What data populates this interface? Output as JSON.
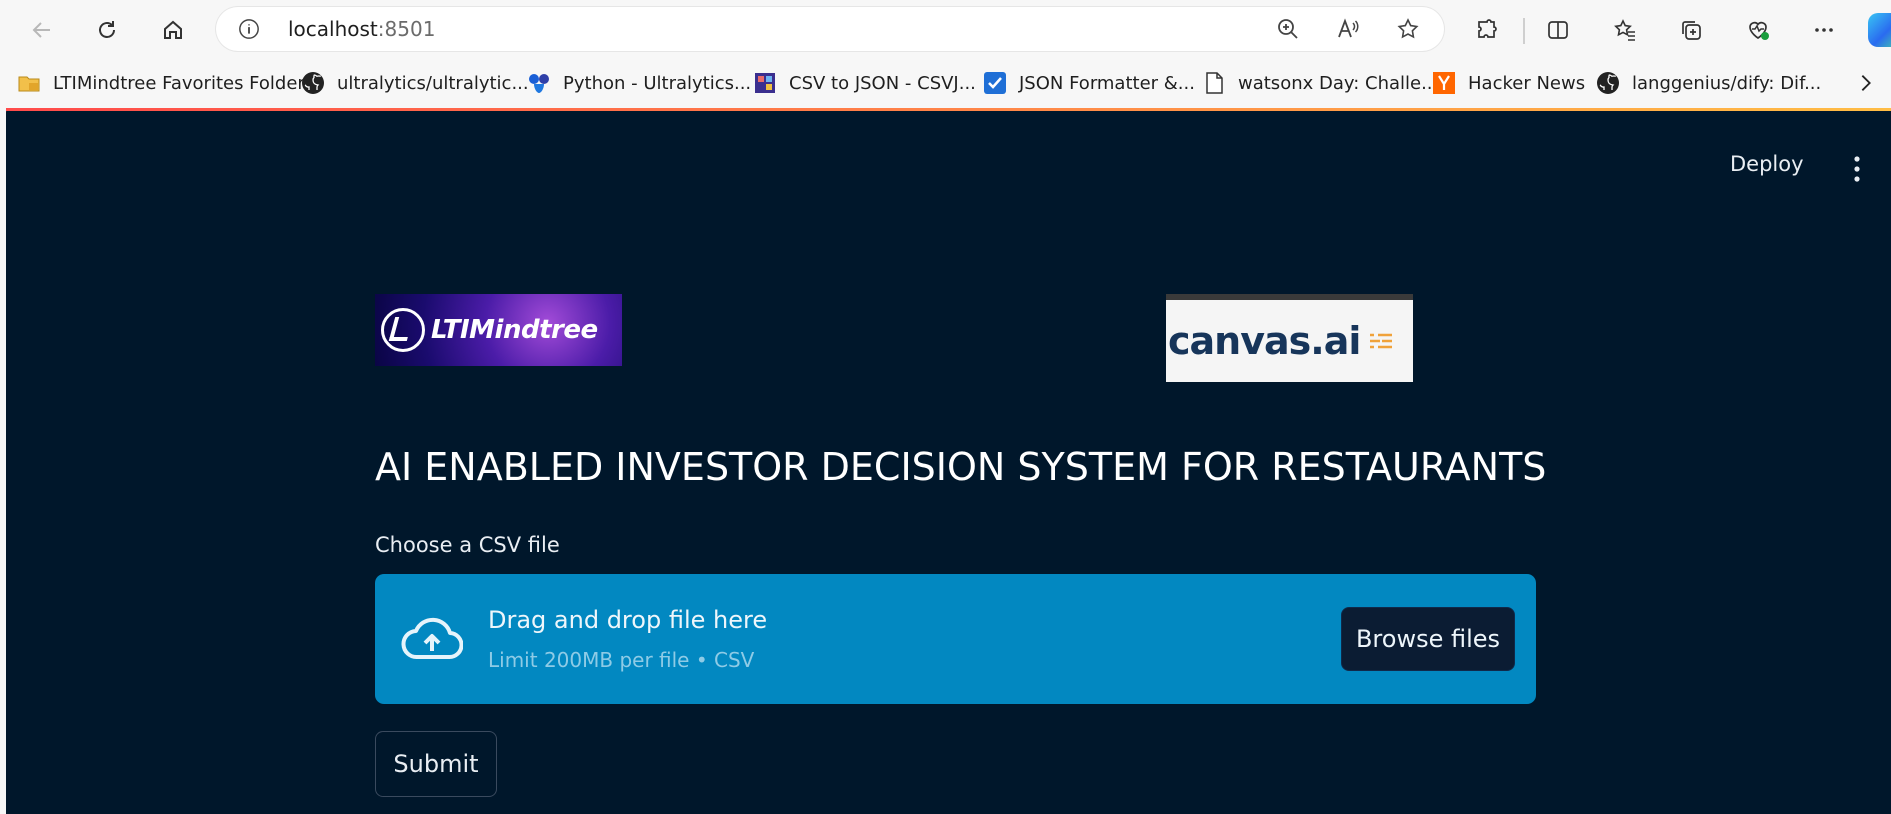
{
  "browser": {
    "url_host": "localhost",
    "url_port": ":8501",
    "icons": [
      "back-arrow-icon",
      "refresh-icon",
      "home-icon",
      "info-icon",
      "zoom-icon",
      "read-aloud-icon",
      "favorite-star-icon",
      "extensions-icon",
      "split-screen-icon",
      "favorites-icon",
      "collections-icon",
      "browser-essentials-icon",
      "more-icon",
      "copilot-icon"
    ]
  },
  "bookmarks": [
    {
      "label": "LTIMindtree Favorites Folder",
      "icon": "folder-icon"
    },
    {
      "label": "ultralytics/ultralytic...",
      "icon": "github-icon"
    },
    {
      "label": "Python - Ultralytics...",
      "icon": "ultralytics-icon"
    },
    {
      "label": "CSV to JSON - CSVJ...",
      "icon": "csvjson-icon"
    },
    {
      "label": "JSON Formatter &...",
      "icon": "checkbox-icon"
    },
    {
      "label": "watsonx Day: Challe...",
      "icon": "page-icon"
    },
    {
      "label": "Hacker News",
      "icon": "hacker-news-icon"
    },
    {
      "label": "langgenius/dify: Dif...",
      "icon": "github-icon"
    }
  ],
  "app": {
    "deploy_label": "Deploy",
    "logo_left_text": "LTIMindtree",
    "logo_right_text": "canvas.ai",
    "title": "AI ENABLED INVESTOR DECISION SYSTEM FOR RESTAURANTS",
    "uploader": {
      "label": "Choose a CSV file",
      "drop_text": "Drag and drop file here",
      "limit_text": "Limit 200MB per file • CSV",
      "browse_label": "Browse files"
    },
    "submit_label": "Submit"
  },
  "colors": {
    "app_background": "#00172b",
    "dropzone": "#0288c1",
    "browse_button": "#0b1c33"
  }
}
